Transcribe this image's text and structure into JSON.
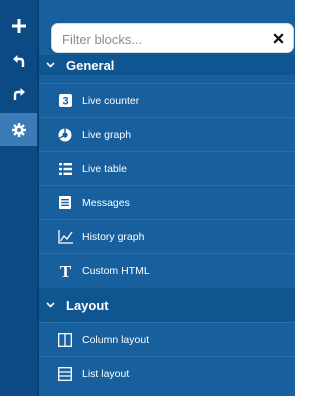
{
  "toolbar": {
    "buttons": [
      {
        "name": "add",
        "icon": "plus-icon"
      },
      {
        "name": "undo",
        "icon": "undo-icon"
      },
      {
        "name": "redo",
        "icon": "redo-icon"
      },
      {
        "name": "settings",
        "icon": "gear-icon"
      }
    ]
  },
  "filter": {
    "placeholder": "Filter blocks...",
    "value": ""
  },
  "groups": [
    {
      "title": "General",
      "expanded": true,
      "blocks": [
        {
          "label": "Live counter",
          "icon": "number-3-icon"
        },
        {
          "label": "Live graph",
          "icon": "pie-chart-icon"
        },
        {
          "label": "Live table",
          "icon": "list-table-icon"
        },
        {
          "label": "Messages",
          "icon": "message-list-icon"
        },
        {
          "label": "History graph",
          "icon": "line-chart-icon"
        },
        {
          "label": "Custom HTML",
          "icon": "text-t-icon"
        }
      ]
    },
    {
      "title": "Layout",
      "expanded": true,
      "blocks": [
        {
          "label": "Column layout",
          "icon": "columns-icon"
        },
        {
          "label": "List layout",
          "icon": "rows-icon"
        }
      ]
    }
  ],
  "colors": {
    "toolbar": "#0c4a85",
    "toolbar_active": "#3b7bb8",
    "panel": "#175f9d",
    "group_header": "#0f5690"
  }
}
